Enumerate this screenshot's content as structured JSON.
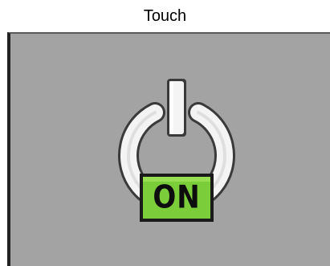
{
  "title": "Touch",
  "power_toggle": {
    "state_label": "ON",
    "icon": "power-icon",
    "colors": {
      "panel_background": "#a3a3a3",
      "symbol_fill": "#f4f4f4",
      "symbol_outline": "#3a3a3a",
      "badge_fill": "#7ccd3a",
      "badge_outline": "#1a1a1a"
    }
  }
}
